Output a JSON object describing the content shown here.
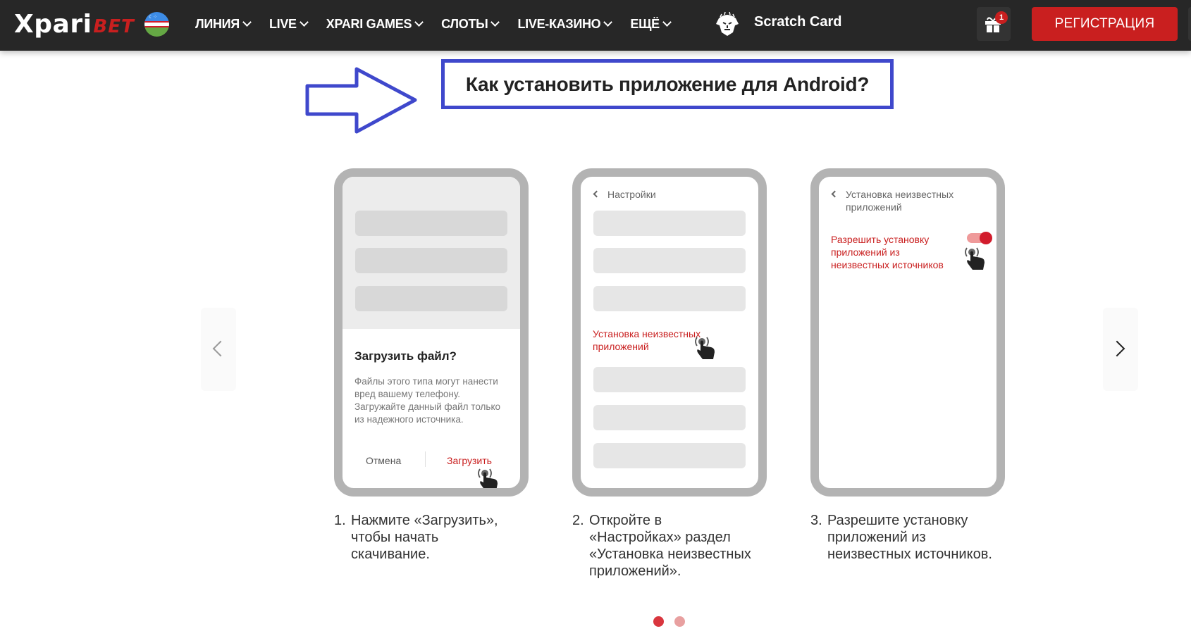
{
  "header": {
    "logo_main": "Xpari",
    "logo_accent": "BET",
    "flag": "uzbekistan-flag",
    "nav": [
      {
        "label": "ЛИНИЯ",
        "has_dropdown": true
      },
      {
        "label": "LIVE",
        "has_dropdown": true
      },
      {
        "label": "XPARI GAMES",
        "has_dropdown": true
      },
      {
        "label": "СЛОТЫ",
        "has_dropdown": true
      },
      {
        "label": "LIVE-КАЗИНО",
        "has_dropdown": true
      },
      {
        "label": "ЕЩЁ",
        "has_dropdown": true
      }
    ],
    "scratch_card_label": "Scratch Card",
    "gift_badge_count": "1",
    "register_label": "РЕГИСТРАЦИЯ"
  },
  "page": {
    "title": "Как установить приложение для Android?"
  },
  "steps": [
    {
      "number": "1.",
      "caption": "Нажмите «Загрузить», чтобы начать скачивание.",
      "phone": {
        "dialog_title": "Загрузить файл?",
        "dialog_text": "Файлы этого типа могут нанести вред вашему телефону. Загружайте данный файл только из надежного источника.",
        "cancel_label": "Отмена",
        "confirm_label": "Загрузить"
      }
    },
    {
      "number": "2.",
      "caption": "Откройте в «Настройках» раздел «Установка неизвестных приложений».",
      "phone": {
        "header": "Настройки",
        "highlight": "Установка неизвестных приложений"
      }
    },
    {
      "number": "3.",
      "caption": "Разрешите установку приложений из неизвестных источников.",
      "phone": {
        "header": "Установка неизвестных приложений",
        "setting_label": "Разрешить установку приложений из неизвестных источников",
        "toggle_on": true
      }
    }
  ],
  "pagination": {
    "total": 2,
    "active": 1
  },
  "colors": {
    "brand_red": "#c91f1f",
    "header_bg": "#272727",
    "annotation_blue": "#3f48cc",
    "dot_active": "#d9363e",
    "dot_inactive": "#e8a0a0"
  }
}
